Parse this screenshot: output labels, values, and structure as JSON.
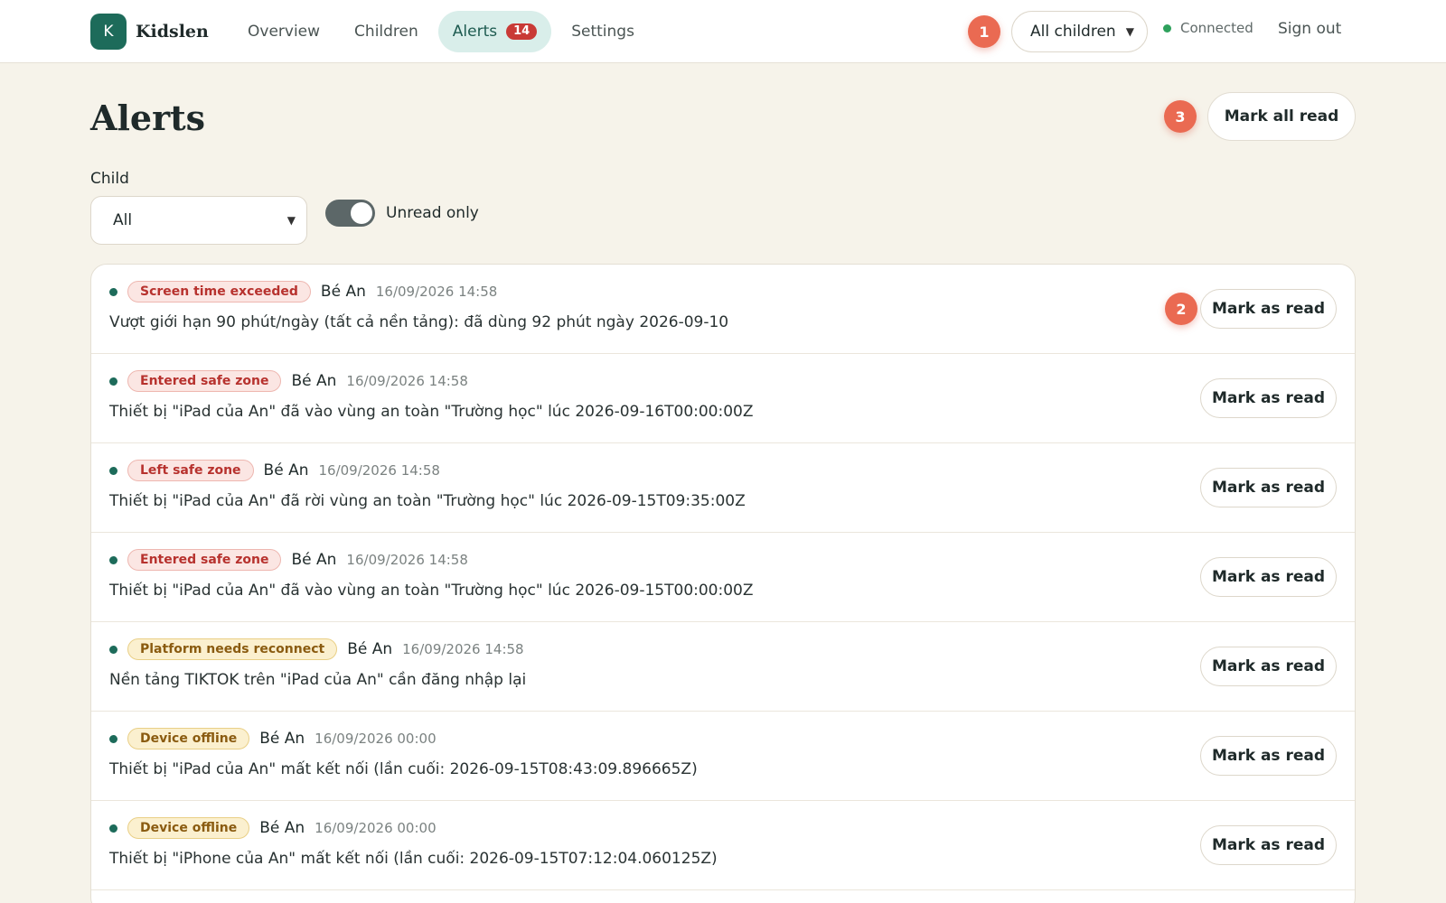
{
  "app": {
    "logo_letter": "K",
    "name": "Kidslen"
  },
  "nav": {
    "overview": "Overview",
    "children": "Children",
    "alerts": "Alerts",
    "alerts_count": "14",
    "settings": "Settings"
  },
  "header": {
    "marker_1": "1",
    "child_selector": "All children",
    "connection_status": "Connected",
    "sign_out": "Sign out"
  },
  "page": {
    "title": "Alerts",
    "marker_3": "3",
    "mark_all_read": "Mark all read",
    "filter_label": "Child",
    "filter_value": "All",
    "unread_only_label": "Unread only",
    "unread_only_enabled": true
  },
  "alerts": [
    {
      "tag": "Screen time exceeded",
      "tag_color": "red",
      "child": "Bé An",
      "time": "16/09/2026 14:58",
      "message": "Vượt giới hạn 90 phút/ngày (tất cả nền tảng): đã dùng 92 phút ngày 2026-09-10",
      "action": "Mark as read",
      "marker": "2"
    },
    {
      "tag": "Entered safe zone",
      "tag_color": "red",
      "child": "Bé An",
      "time": "16/09/2026 14:58",
      "message": "Thiết bị \"iPad của An\" đã vào vùng an toàn \"Trường học\" lúc 2026-09-16T00:00:00Z",
      "action": "Mark as read"
    },
    {
      "tag": "Left safe zone",
      "tag_color": "red",
      "child": "Bé An",
      "time": "16/09/2026 14:58",
      "message": "Thiết bị \"iPad của An\" đã rời vùng an toàn \"Trường học\" lúc 2026-09-15T09:35:00Z",
      "action": "Mark as read"
    },
    {
      "tag": "Entered safe zone",
      "tag_color": "red",
      "child": "Bé An",
      "time": "16/09/2026 14:58",
      "message": "Thiết bị \"iPad của An\" đã vào vùng an toàn \"Trường học\" lúc 2026-09-15T00:00:00Z",
      "action": "Mark as read"
    },
    {
      "tag": "Platform needs reconnect",
      "tag_color": "yellow",
      "child": "Bé An",
      "time": "16/09/2026 14:58",
      "message": "Nền tảng TIKTOK trên \"iPad của An\" cần đăng nhập lại",
      "action": "Mark as read"
    },
    {
      "tag": "Device offline",
      "tag_color": "yellow",
      "child": "Bé An",
      "time": "16/09/2026 00:00",
      "message": "Thiết bị \"iPad của An\" mất kết nối (lần cuối: 2026-09-15T08:43:09.896665Z)",
      "action": "Mark as read"
    },
    {
      "tag": "Device offline",
      "tag_color": "yellow",
      "child": "Bé An",
      "time": "16/09/2026 00:00",
      "message": "Thiết bị \"iPhone của An\" mất kết nối (lần cuối: 2026-09-15T07:12:04.060125Z)",
      "action": "Mark as read"
    }
  ],
  "colors": {
    "brand": "#1d6b5a",
    "background": "#f6f3ea",
    "badge_red": "#c93a36",
    "marker": "#ea6a52",
    "connected": "#2ea15c"
  }
}
